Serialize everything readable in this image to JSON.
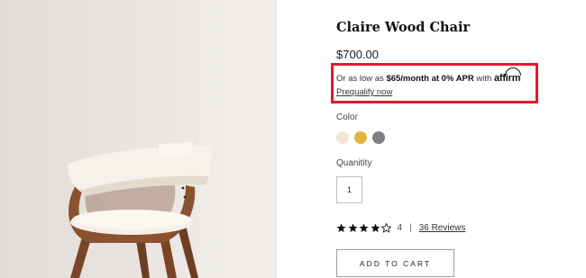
{
  "product": {
    "title": "Claire Wood Chair",
    "price": "$700.00",
    "image_alt_icon": "chair-photo"
  },
  "financing": {
    "prefix": "Or as low as ",
    "offer": "$65/month at 0% APR",
    "suffix": " with ",
    "brand": "affirm",
    "link": "Prequalify now",
    "highlight_color": "#e21b2b"
  },
  "colors": {
    "label": "Color",
    "swatches": [
      {
        "name": "cream",
        "hex": "#f2e6d6"
      },
      {
        "name": "mustard",
        "hex": "#e3b53a"
      },
      {
        "name": "gray",
        "hex": "#7f7f7f"
      }
    ]
  },
  "quantity": {
    "label": "Quanitity",
    "value": "1"
  },
  "rating": {
    "stars": 4,
    "max": 5,
    "count": "4",
    "separator": "|",
    "reviews_link": "36 Reviews"
  },
  "cart": {
    "button_label": "ADD TO CART"
  }
}
